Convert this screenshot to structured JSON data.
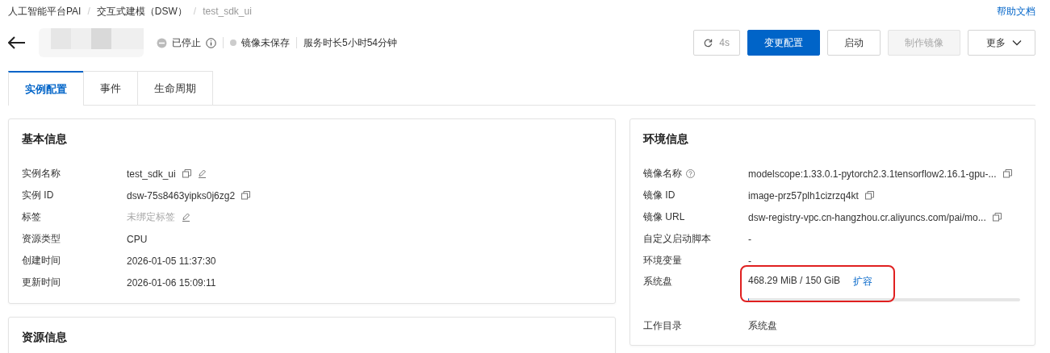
{
  "breadcrumb": [
    {
      "label": "人工智能平台PAI"
    },
    {
      "sep": "/",
      "label": "交互式建模（DSW）"
    },
    {
      "sep": "/",
      "label": "test_sdk_ui"
    }
  ],
  "help_link": "帮助文档",
  "header": {
    "status": "已停止",
    "image_status": "镜像未保存",
    "duration": "服务时长5小时54分钟"
  },
  "actions": [
    {
      "kind": "refresh",
      "label": "4s",
      "disabled": false
    },
    {
      "kind": "primary",
      "label": "变更配置",
      "disabled": false
    },
    {
      "kind": "default",
      "label": "启动",
      "disabled": false
    },
    {
      "kind": "default",
      "label": "制作镜像",
      "disabled": true
    },
    {
      "kind": "dropdown",
      "label": "更多",
      "disabled": false
    }
  ],
  "tabs": [
    {
      "label": "实例配置",
      "selected": true
    },
    {
      "label": "事件",
      "selected": false
    },
    {
      "label": "生命周期",
      "selected": false
    }
  ],
  "basic_info": {
    "title": "基本信息",
    "rows": [
      {
        "label": "实例名称",
        "value": "test_sdk_ui",
        "copy": true,
        "edit": true,
        "muted": false
      },
      {
        "label": "实例 ID",
        "value": "dsw-75s8463yipks0j6zg2",
        "copy": true,
        "edit": false,
        "muted": false
      },
      {
        "label": "标签",
        "value": "未绑定标签",
        "copy": false,
        "edit": true,
        "muted": true
      },
      {
        "label": "资源类型",
        "value": "CPU",
        "copy": false,
        "edit": false,
        "muted": false
      },
      {
        "label": "创建时间",
        "value": "2026-01-05 11:37:30",
        "copy": false,
        "edit": false,
        "muted": false
      },
      {
        "label": "更新时间",
        "value": "2026-01-06 15:09:11",
        "copy": false,
        "edit": false,
        "muted": false
      }
    ]
  },
  "resource_info": {
    "title": "资源信息"
  },
  "env_info": {
    "title": "环境信息",
    "rows": [
      {
        "kind": "text",
        "label": "镜像名称",
        "help": true,
        "value": "modelscope:1.33.0.1-pytorch2.3.1tensorflow2.16.1-gpu-...",
        "copy": true
      },
      {
        "kind": "text",
        "label": "镜像 ID",
        "help": false,
        "value": "image-prz57plh1cizrzq4kt",
        "copy": true
      },
      {
        "kind": "text",
        "label": "镜像 URL",
        "help": false,
        "value": "dsw-registry-vpc.cn-hangzhou.cr.aliyuncs.com/pai/mo...",
        "copy": true
      },
      {
        "kind": "text",
        "label": "自定义启动脚本",
        "help": false,
        "value": "-",
        "copy": false
      },
      {
        "kind": "text",
        "label": "环境变量",
        "help": false,
        "value": "-",
        "copy": false
      },
      {
        "kind": "disk",
        "label": "系统盘",
        "value": "468.29 MiB / 150 GiB",
        "link": "扩容",
        "level": 0.003,
        "highlight": true
      },
      {
        "kind": "text",
        "label": "工作目录",
        "help": false,
        "value": "系统盘",
        "copy": false
      }
    ]
  }
}
